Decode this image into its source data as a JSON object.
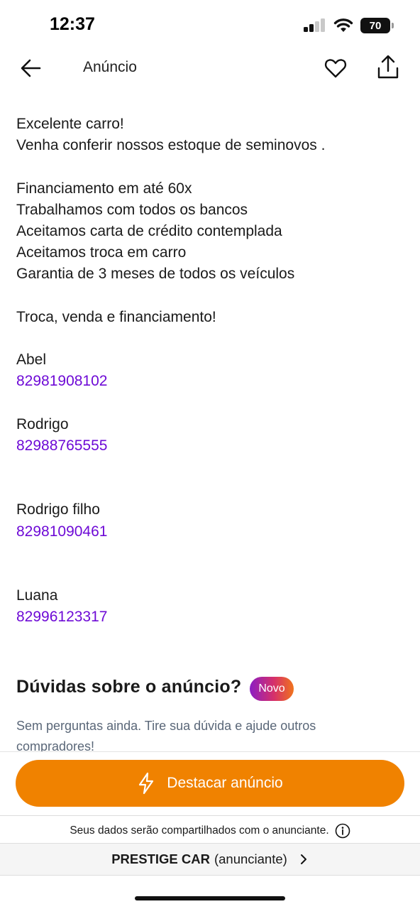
{
  "status_bar": {
    "time": "12:37",
    "battery": "70"
  },
  "header": {
    "title": "Anúncio"
  },
  "description": {
    "intro_lines": [
      "Excelente carro!",
      "Venha conferir nossos estoque de seminovos ."
    ],
    "feature_lines": [
      "Financiamento em até 60x",
      "Trabalhamos com todos os bancos",
      "Aceitamos carta de crédito contemplada",
      "Aceitamos troca em carro",
      "Garantia de 3 meses de todos os veículos"
    ],
    "tagline": "Troca, venda e financiamento!",
    "contacts": [
      {
        "name": "Abel",
        "phone": "82981908102"
      },
      {
        "name": "Rodrigo",
        "phone": "82988765555"
      },
      {
        "name": "Rodrigo filho",
        "phone": "82981090461"
      },
      {
        "name": "Luana",
        "phone": "82996123317"
      }
    ]
  },
  "questions": {
    "title": "Dúvidas sobre o anúncio?",
    "badge": "Novo",
    "empty_text": "Sem perguntas ainda. Tire sua dúvida e ajude outros compradores!"
  },
  "footer": {
    "highlight_button": "Destacar anúncio",
    "share_note": "Seus dados serão compartilhados com o anunciante.",
    "seller_name": "PRESTIGE CAR",
    "seller_role": "(anunciante)"
  },
  "colors": {
    "accent_purple": "#6e0ad6",
    "button_orange": "#f08200",
    "muted_text": "#5a6778"
  }
}
